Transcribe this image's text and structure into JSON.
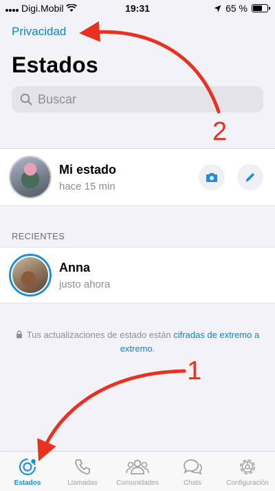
{
  "status_bar": {
    "carrier": "Digi.Mobil",
    "time": "19:31",
    "battery": "65 %"
  },
  "header": {
    "privacy_link": "Privacidad",
    "title": "Estados"
  },
  "search": {
    "placeholder": "Buscar"
  },
  "my_status": {
    "name": "Mi estado",
    "subtitle": "hace 15 min"
  },
  "recent": {
    "header": "RECIENTES",
    "items": [
      {
        "name": "Anna",
        "subtitle": "justo ahora"
      }
    ]
  },
  "encryption_note": {
    "text_before": "Tus actualizaciones de estado están ",
    "link": "cifradas de extremo a extremo",
    "text_after": "."
  },
  "tab_bar": {
    "tabs": [
      {
        "label": "Estados",
        "icon": "status-icon",
        "active": true
      },
      {
        "label": "Llamadas",
        "icon": "phone-icon",
        "active": false
      },
      {
        "label": "Comunidades",
        "icon": "communities-icon",
        "active": false
      },
      {
        "label": "Chats",
        "icon": "chats-icon",
        "active": false
      },
      {
        "label": "Configuración",
        "icon": "gear-icon",
        "active": false
      }
    ]
  },
  "annotations": {
    "label_1": "1",
    "label_2": "2",
    "color": "#e8311e"
  },
  "colors": {
    "accent": "#1f8ed8",
    "link": "#0a84c7"
  }
}
